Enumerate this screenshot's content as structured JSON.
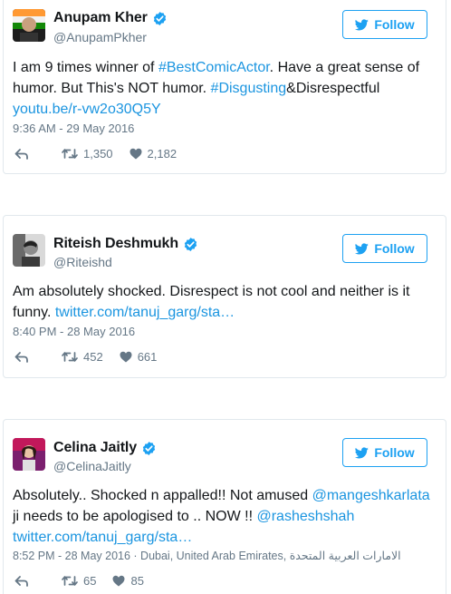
{
  "tweets": [
    {
      "name": "Anupam Kher",
      "handle": "@AnupamPkher",
      "follow_label": "Follow",
      "text_parts": [
        {
          "t": "I am 9 times winner of ",
          "link": false
        },
        {
          "t": "#BestComicActor",
          "link": true
        },
        {
          "t": ". Have a great sense of humor. But This's NOT humor. ",
          "link": false
        },
        {
          "t": "#Disgusting",
          "link": true
        },
        {
          "t": "&Disrespectful ",
          "link": false
        },
        {
          "t": "youtu.be/r-vw2o30Q5Y",
          "link": true
        }
      ],
      "meta": "9:36 AM - 29 May 2016",
      "retweets": "1,350",
      "likes": "2,182"
    },
    {
      "name": "Riteish Deshmukh",
      "handle": "@Riteishd",
      "follow_label": "Follow",
      "text_parts": [
        {
          "t": "Am absolutely shocked. Disrespect is not cool and neither is it funny. ",
          "link": false
        },
        {
          "t": "twitter.com/tanuj_garg/sta…",
          "link": true
        }
      ],
      "meta": "8:40 PM - 28 May 2016",
      "retweets": "452",
      "likes": "661"
    },
    {
      "name": "Celina Jaitly",
      "handle": "@CelinaJaitly",
      "follow_label": "Follow",
      "text_parts": [
        {
          "t": "Absolutely.. Shocked n appalled!! Not amused ",
          "link": false
        },
        {
          "t": "@mangeshkarlata",
          "link": true
        },
        {
          "t": " ji needs to be apologised to .. NOW !! ",
          "link": false
        },
        {
          "t": "@rasheshshah",
          "link": true
        },
        {
          "t": " ",
          "link": false
        },
        {
          "t": "twitter.com/tanuj_garg/sta…",
          "link": true
        }
      ],
      "meta": "8:52 PM - 28 May 2016 · Dubai, United Arab Emirates, الامارات العربية المتحدة",
      "retweets": "65",
      "likes": "85"
    }
  ],
  "colors": {
    "accent": "#1da1f2",
    "link": "#1b95e0",
    "verified": "#1da1f2",
    "muted": "#657786",
    "border": "#e1e8ed"
  },
  "icons": [
    "twitter-bird-icon",
    "verified-badge-icon",
    "reply-icon",
    "retweet-icon",
    "heart-icon"
  ]
}
